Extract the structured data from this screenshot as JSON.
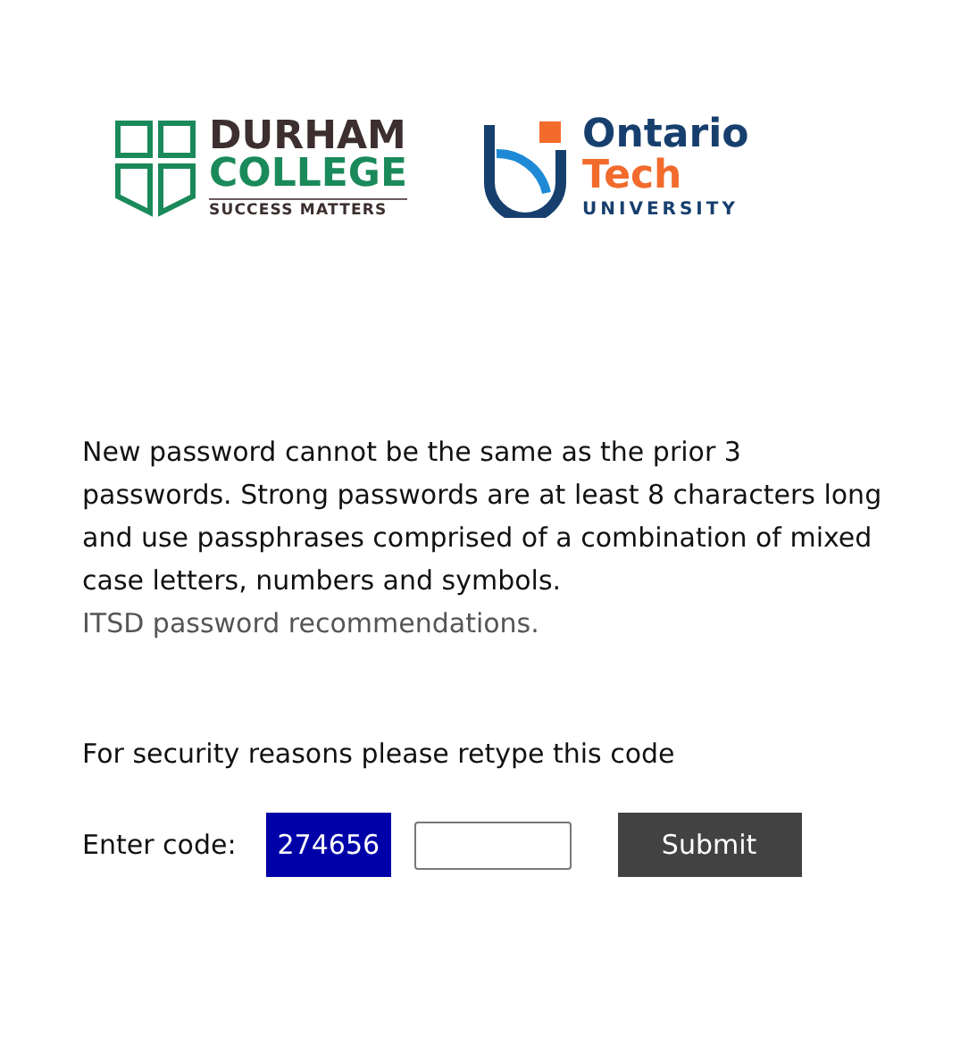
{
  "logos": [
    {
      "kind": "durham",
      "lines": [
        "DURHAM",
        "COLLEGE"
      ],
      "tagline": "SUCCESS MATTERS"
    },
    {
      "kind": "ontario",
      "lines": [
        "Ontario",
        "Tech"
      ],
      "tagline": "UNIVERSITY"
    }
  ],
  "notice": "New password cannot be the same as the prior 3 passwords. Strong passwords are at least 8 characters long and use passphrases comprised of a combination of mixed case letters, numbers and symbols.",
  "recommendations_link": "ITSD password recommendations.",
  "security_prompt": "For security reasons please retype this code",
  "code_label": "Enter code:",
  "code": "274656",
  "submit": "Submit"
}
